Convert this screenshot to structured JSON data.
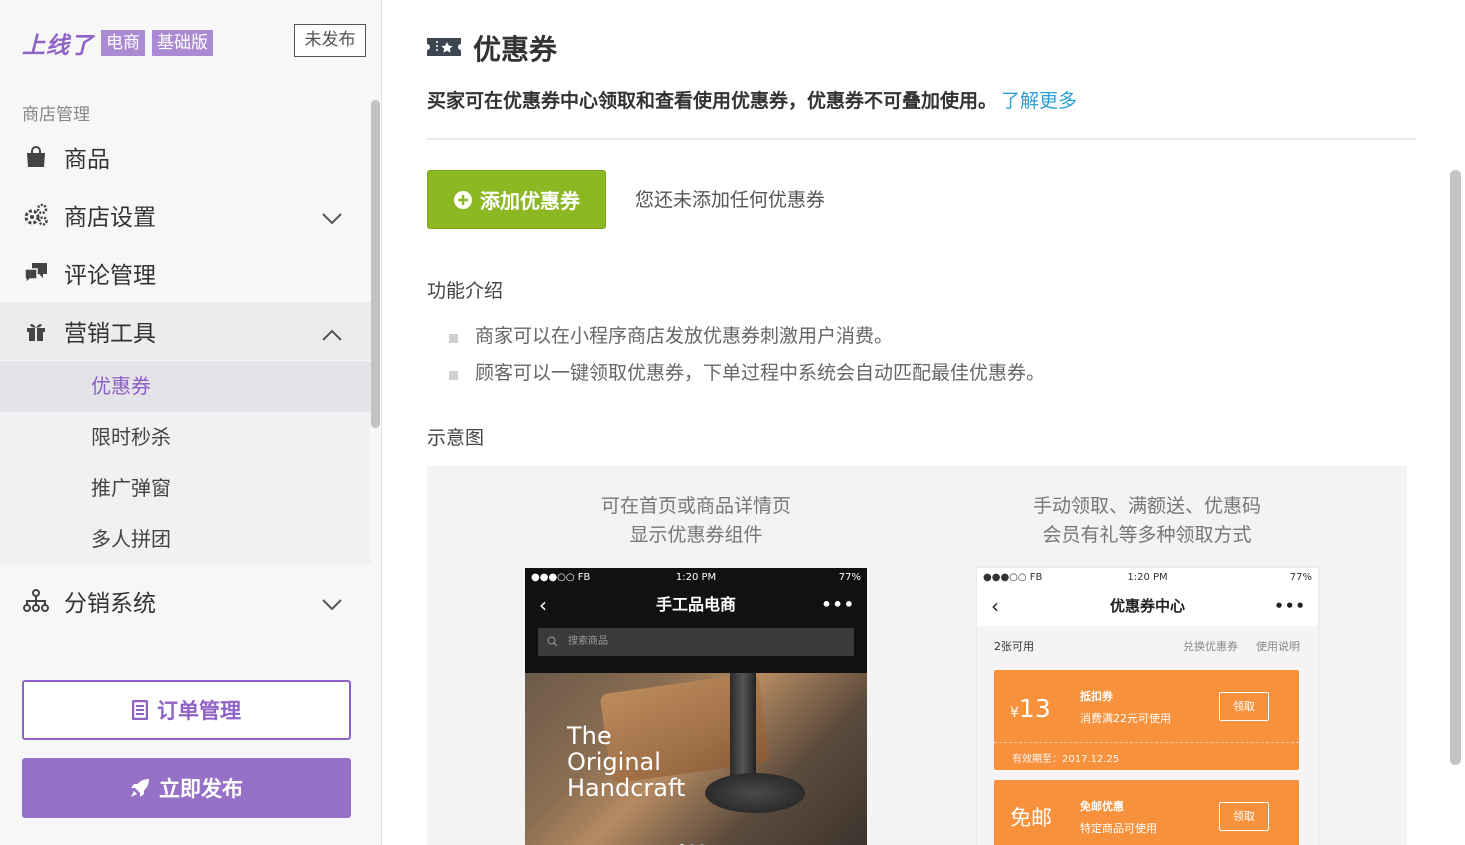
{
  "sidebar": {
    "brand_logo": "上线了",
    "brand_tags": [
      "电商",
      "基础版"
    ],
    "publish_state": "未发布",
    "section_label": "商店管理",
    "items": [
      {
        "label": "商品",
        "icon": "shopping-bag-icon"
      },
      {
        "label": "商店设置",
        "icon": "gears-icon"
      },
      {
        "label": "评论管理",
        "icon": "comments-icon"
      },
      {
        "label": "营销工具",
        "icon": "gift-icon"
      },
      {
        "label": "分销系统",
        "icon": "sitemap-icon"
      }
    ],
    "marketing_sub": [
      "优惠券",
      "限时秒杀",
      "推广弹窗",
      "多人拼团"
    ],
    "order_button": "订单管理",
    "publish_button": "立即发布"
  },
  "main": {
    "title": "优惠券",
    "description": "买家可在优惠券中心领取和查看使用优惠券，优惠券不可叠加使用。",
    "learn_more": "了解更多",
    "add_button": "添加优惠券",
    "empty_text": "您还未添加任何优惠券",
    "feature_title": "功能介绍",
    "features": [
      "商家可以在小程序商店发放优惠券刺激用户消费。",
      "顾客可以一键领取优惠券，下单过程中系统会自动匹配最佳优惠券。"
    ],
    "diagram_title": "示意图"
  },
  "diagram": {
    "left_caption": [
      "可在首页或商品详情页",
      "显示优惠券组件"
    ],
    "right_caption": [
      "手动领取、满额送、优惠码",
      "会员有礼等多种领取方式"
    ],
    "phone_left": {
      "status_left": "●●●○○ FB",
      "status_time": "1:20 PM",
      "status_right": "77%",
      "title": "手工品电商",
      "search_placeholder": "搜索商品",
      "hero_text": [
        "The",
        "Original",
        "Handcraft"
      ]
    },
    "phone_right": {
      "status_left": "●●●○○ FB",
      "status_time": "1:20 PM",
      "status_right": "77%",
      "title": "优惠券中心",
      "available": "2张可用",
      "redeem": "兑换优惠券",
      "instructions": "使用说明",
      "coupons": [
        {
          "amount_prefix": "¥",
          "amount": "13",
          "name": "抵扣券",
          "condition": "消费满22元可使用",
          "action": "领取",
          "validity": "有效期至：2017.12.25"
        },
        {
          "amount": "免邮",
          "name": "免邮优惠",
          "condition": "特定商品可使用",
          "action": "领取"
        }
      ]
    }
  },
  "colors": {
    "brand_purple": "#8f63c6",
    "add_green": "#8cb923",
    "link_blue": "#2a9fd8",
    "coupon_orange": "#f7913c"
  }
}
